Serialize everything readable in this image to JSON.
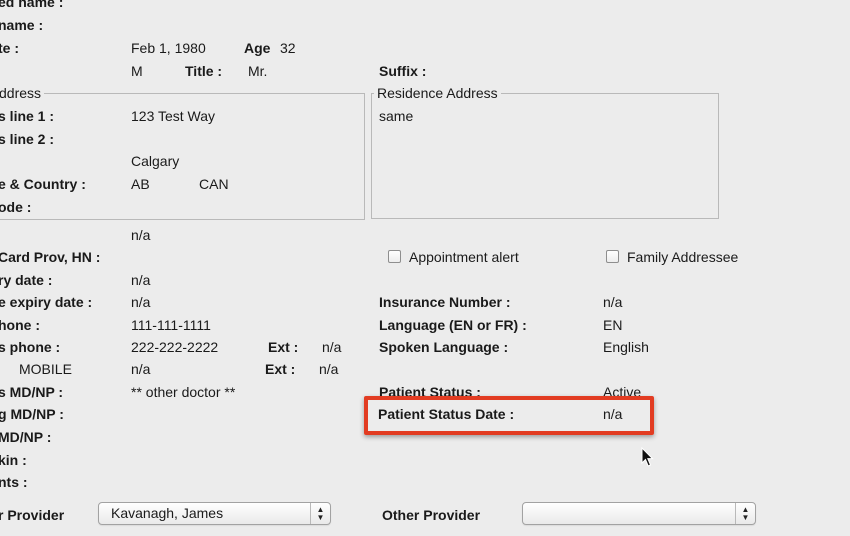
{
  "labels": {
    "preferred_name": "ed name :",
    "alias_name": "name :",
    "birth_date": "te :",
    "age": "Age",
    "title": "Title :",
    "suffix": "Suffix :",
    "mailing_legend": "ddress",
    "residence_legend": "Residence Address",
    "address_line1": "s line 1 :",
    "address_line2": "s line 2 :",
    "province_country": "e & Country :",
    "postal_code": "ode :",
    "health_card": "Card Prov, HN :",
    "expiry_date": "ry date :",
    "renew_expiry": "e expiry date :",
    "home_phone": "hone :",
    "business_phone": "s phone :",
    "ext1": "Ext :",
    "mobile": "MOBILE",
    "ext2": "Ext :",
    "family_md": "s MD/NP :",
    "referring_md": "g MD/NP :",
    "other_md": "MD/NP :",
    "next_of_kin": "kin :",
    "comments": "nts :",
    "primary_provider": "r Provider",
    "other_provider": "Other Provider",
    "insurance_number": "Insurance Number :",
    "language": "Language (EN or FR) :",
    "spoken_language": "Spoken Language :",
    "patient_status": "Patient Status :",
    "patient_status_date": "Patient Status Date :"
  },
  "values": {
    "birth_date": "Feb 1, 1980",
    "age": "32",
    "sex": "M",
    "title": "Mr.",
    "address_line1": "123 Test Way",
    "city": "Calgary",
    "province": "AB",
    "country": "CAN",
    "residence_address": "same",
    "health_card_top": "n/a",
    "expiry_date": "n/a",
    "renew_expiry": "n/a",
    "home_phone": "111-111-1111",
    "business_phone": "222-222-2222",
    "ext1": "n/a",
    "mobile": "n/a",
    "ext2": "n/a",
    "family_md": "** other doctor **",
    "insurance_number": "n/a",
    "language": "EN",
    "spoken_language": "English",
    "patient_status": "Active",
    "patient_status_date": "n/a",
    "primary_provider": "Kavanagh, James",
    "other_provider": ""
  },
  "checkboxes": {
    "appointment_alert": {
      "label": "Appointment alert",
      "checked": false
    },
    "family_addressee": {
      "label": "Family Addressee",
      "checked": false
    }
  },
  "colors": {
    "background": "#ececec",
    "highlight": "#e23c22"
  }
}
